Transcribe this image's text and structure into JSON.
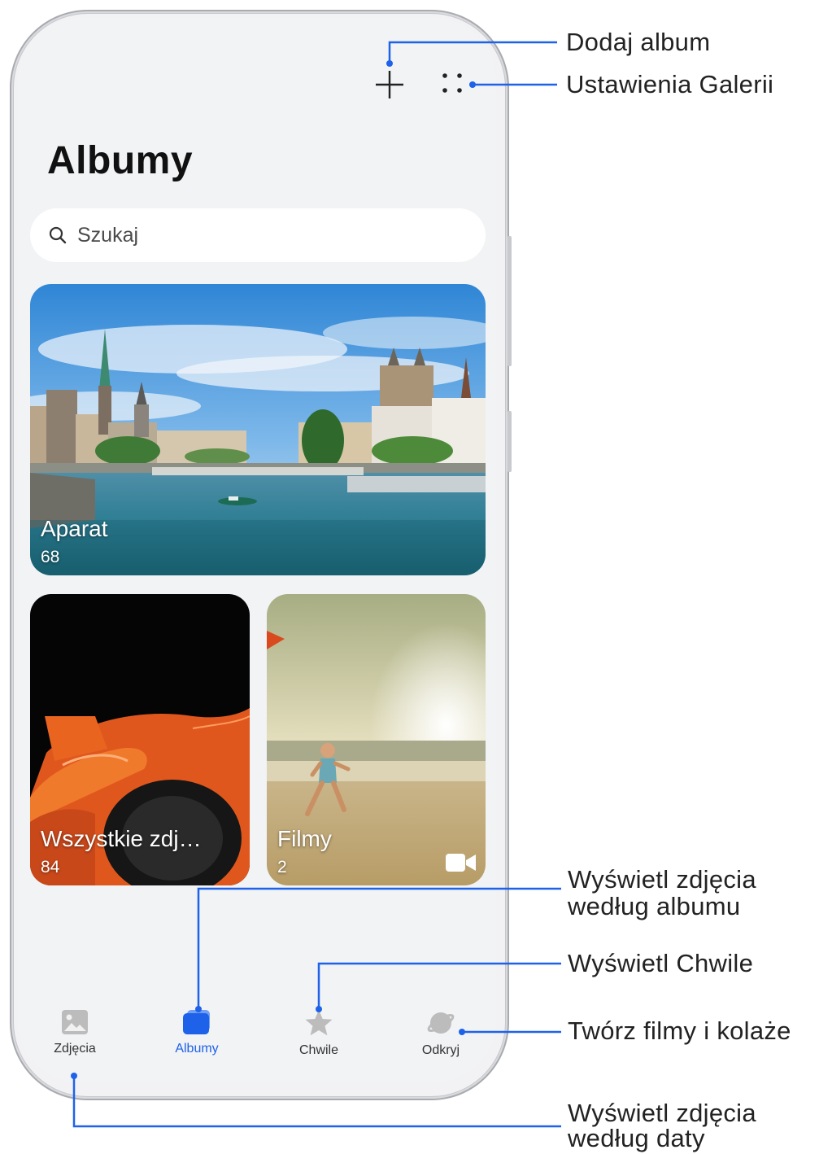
{
  "header": {
    "title": "Albumy",
    "add_icon": "plus-icon",
    "more_icon": "four-dots-icon"
  },
  "search": {
    "placeholder": "Szukaj",
    "icon": "search-icon"
  },
  "albums": [
    {
      "name": "Aparat",
      "count": "68"
    },
    {
      "name": "Wszystkie zdj…",
      "count": "84"
    },
    {
      "name": "Filmy",
      "count": "2",
      "icon": "video-icon"
    }
  ],
  "bottom_nav": {
    "items": [
      {
        "label": "Zdjęcia",
        "icon": "image-icon",
        "active": false
      },
      {
        "label": "Albumy",
        "icon": "albums-icon",
        "active": true
      },
      {
        "label": "Chwile",
        "icon": "star-icon",
        "active": false
      },
      {
        "label": "Odkryj",
        "icon": "planet-icon",
        "active": false
      }
    ]
  },
  "callouts": {
    "add_album": "Dodaj album",
    "gallery_settings": "Ustawienia Galerii",
    "view_by_album_1": "Wyświetl zdjęcia",
    "view_by_album_2": "według albumu",
    "view_moments": "Wyświetl Chwile",
    "create": "Twórz filmy i kolaże",
    "view_by_date_1": "Wyświetl zdjęcia",
    "view_by_date_2": "według daty"
  },
  "colors": {
    "accent": "#1f62ea",
    "callout_line": "#1f62ea",
    "screen_bg": "#f1f3f5"
  }
}
